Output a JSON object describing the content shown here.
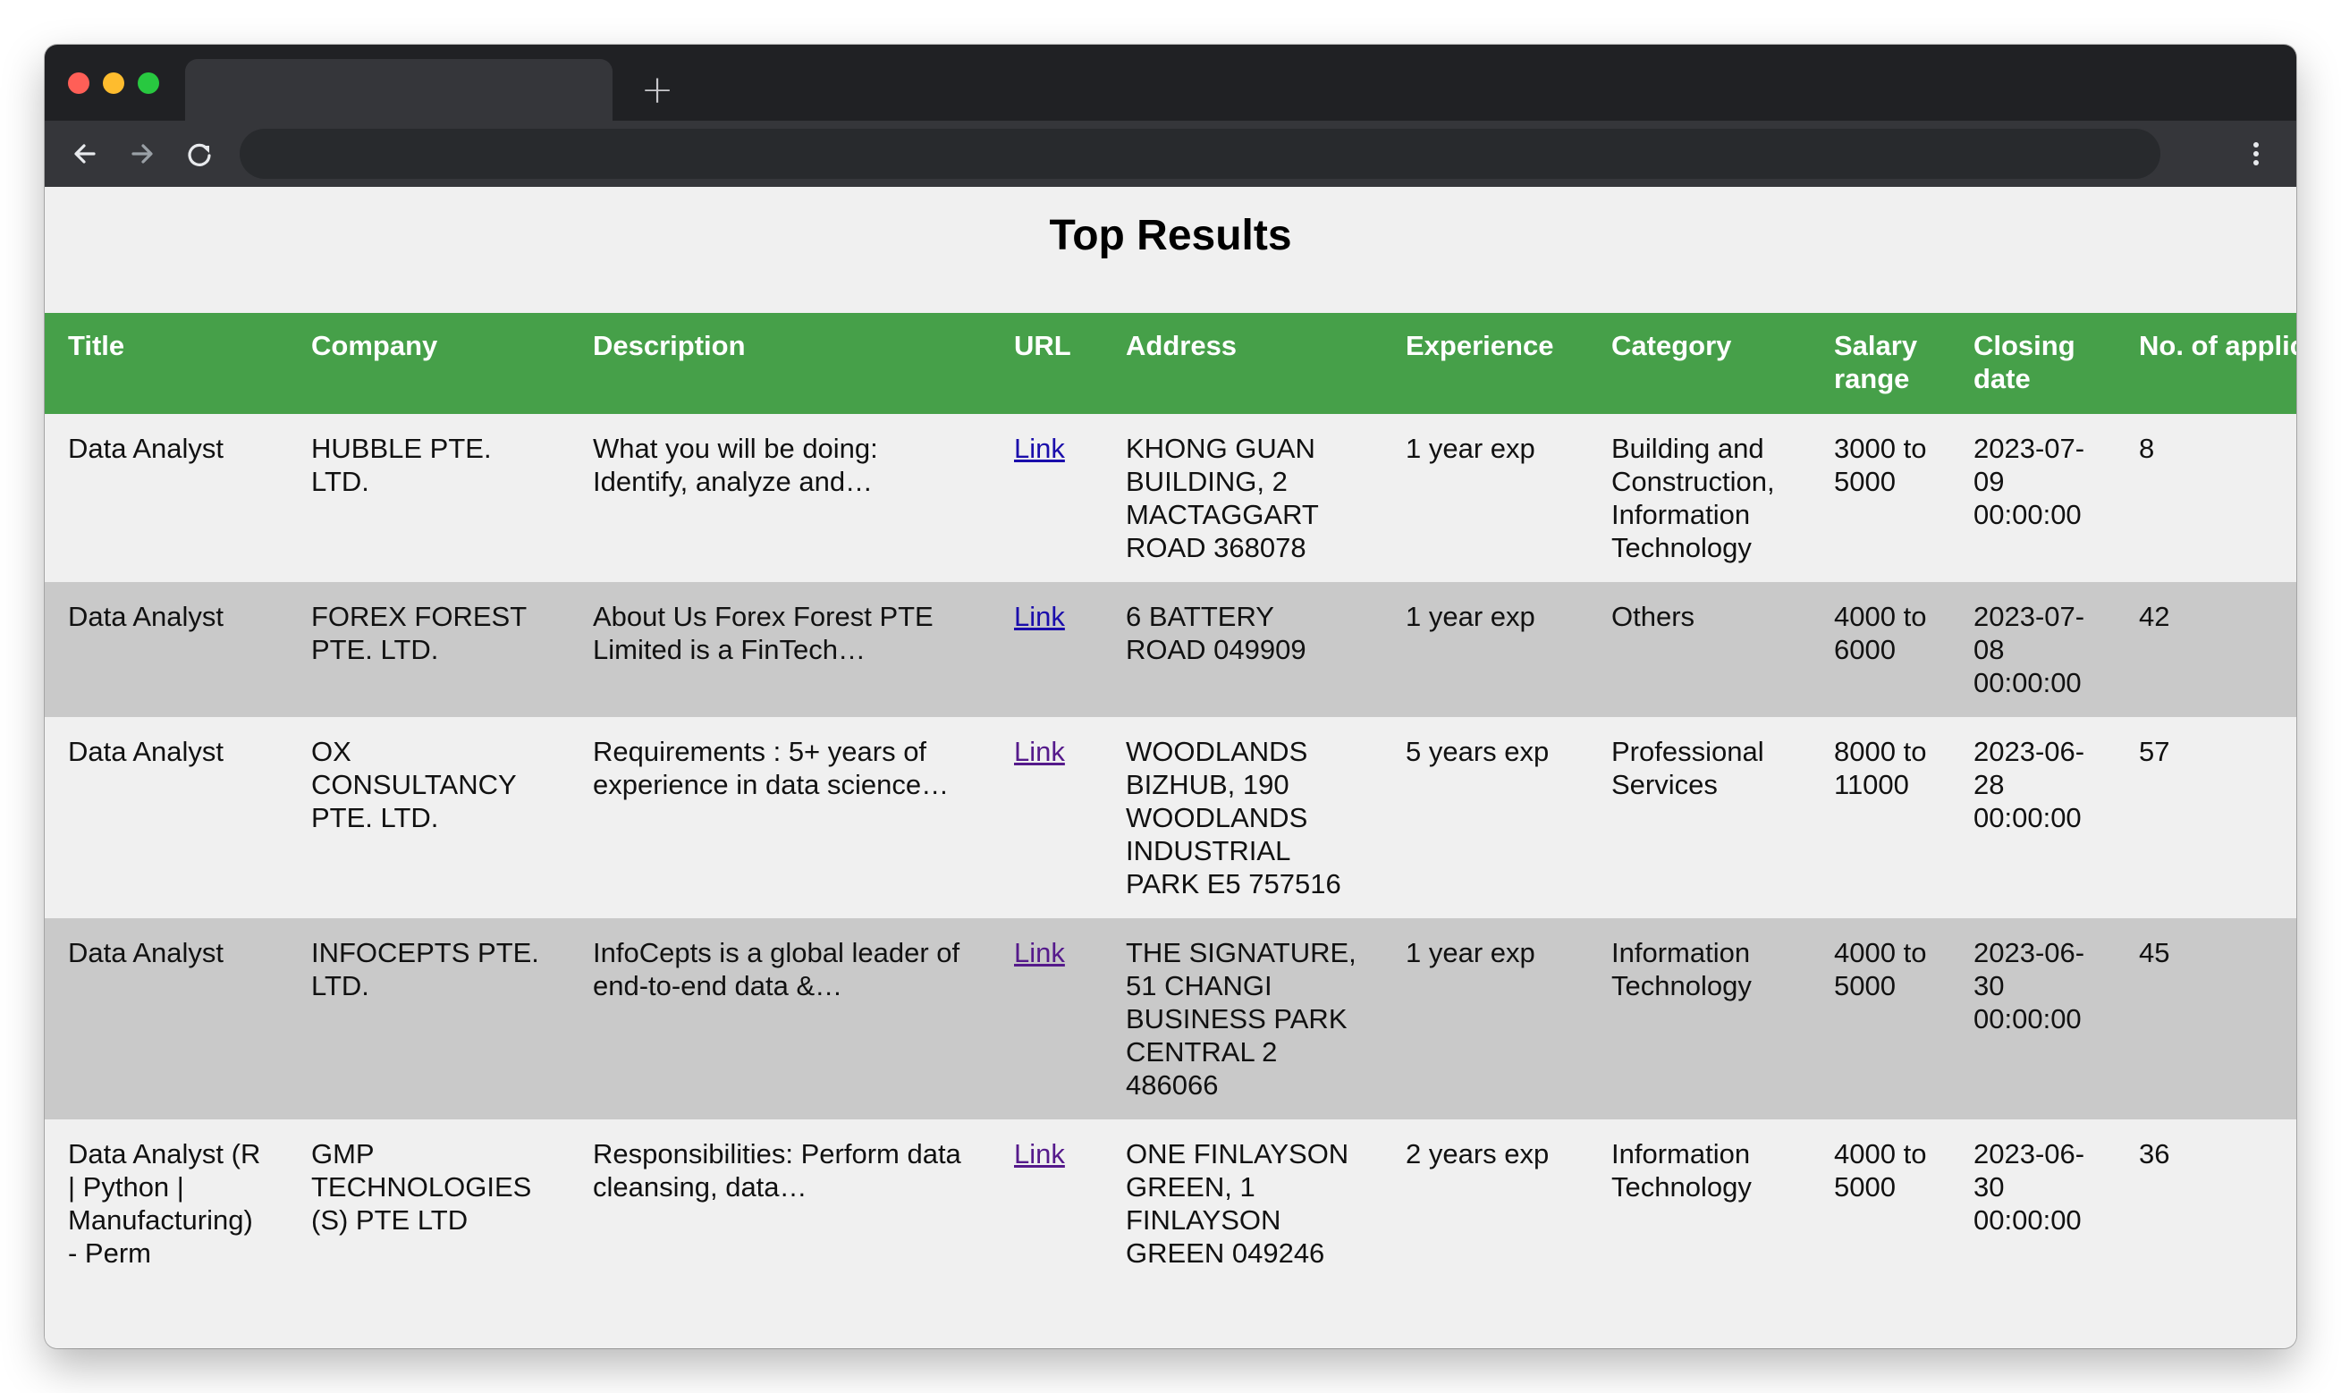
{
  "page": {
    "title": "Top Results"
  },
  "browser": {
    "new_tab_symbol": "+"
  },
  "table": {
    "headers": [
      "Title",
      "Company",
      "Description",
      "URL",
      "Address",
      "Experience",
      "Category",
      "Salary range",
      "Closing date",
      "No. of applications"
    ],
    "rows": [
      {
        "title": "Data Analyst",
        "company": "HUBBLE PTE. LTD.",
        "description": "What you will be doing: Identify, analyze and…",
        "url": "Link",
        "address": "KHONG GUAN BUILDING, 2 MACTAGGART ROAD 368078",
        "experience": "1 year exp",
        "category": "Building and Construction, Information Technology",
        "salary": "3000 to 5000",
        "closing": "2023-07-09 00:00:00",
        "applications": "8"
      },
      {
        "title": "Data Analyst",
        "company": "FOREX FOREST PTE. LTD.",
        "description": "About Us Forex Forest PTE Limited is a FinTech…",
        "url": "Link",
        "address": "6 BATTERY ROAD 049909",
        "experience": "1 year exp",
        "category": "Others",
        "salary": "4000 to 6000",
        "closing": "2023-07-08 00:00:00",
        "applications": "42"
      },
      {
        "title": "Data Analyst",
        "company": "OX CONSULTANCY PTE. LTD.",
        "description": "Requirements : 5+ years of experience in data science…",
        "url": "Link",
        "address": "WOODLANDS BIZHUB, 190 WOODLANDS INDUSTRIAL PARK E5 757516",
        "experience": "5 years exp",
        "category": "Professional Services",
        "salary": "8000 to 11000",
        "closing": "2023-06-28 00:00:00",
        "applications": "57"
      },
      {
        "title": "Data Analyst",
        "company": "INFOCEPTS PTE. LTD.",
        "description": "InfoCepts is a global leader of end-to-end data &…",
        "url": "Link",
        "address": "THE SIGNATURE, 51 CHANGI BUSINESS PARK CENTRAL 2 486066",
        "experience": "1 year exp",
        "category": "Information Technology",
        "salary": "4000 to 5000",
        "closing": "2023-06-30 00:00:00",
        "applications": "45"
      },
      {
        "title": "Data Analyst (R | Python | Manufacturing) - Perm",
        "company": "GMP TECHNOLOGIES (S) PTE LTD",
        "description": "Responsibilities: Perform data cleansing, data…",
        "url": "Link",
        "address": "ONE FINLAYSON GREEN, 1 FINLAYSON GREEN 049246",
        "experience": "2 years exp",
        "category": "Information Technology",
        "salary": "4000 to 5000",
        "closing": "2023-06-30 00:00:00",
        "applications": "36"
      }
    ]
  },
  "colors": {
    "header_bg": "#46a049",
    "row_odd": "#f0f0f0",
    "row_even": "#c9c9c9",
    "link": "#1a0dab",
    "link_visited": "#551a8b"
  }
}
